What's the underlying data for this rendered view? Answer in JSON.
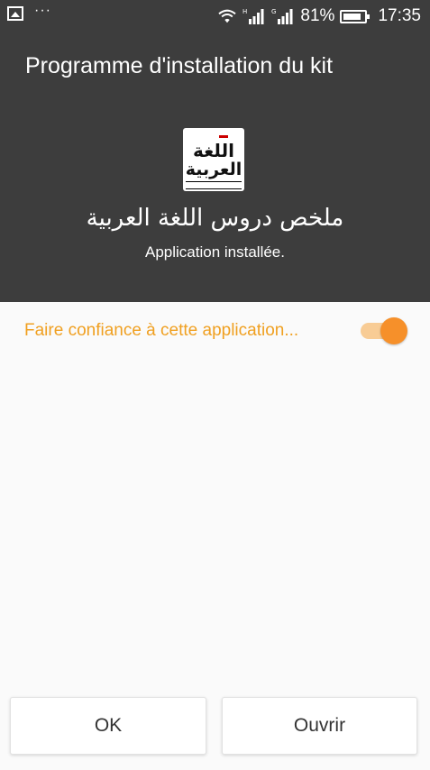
{
  "status_bar": {
    "battery": "81%",
    "time": "17:35",
    "dots": "···",
    "signal_labels": [
      "H",
      "G"
    ]
  },
  "header": {
    "title": "Programme d'installation du kit",
    "app_icon": {
      "line1": "اللغة",
      "line2": "العربية"
    },
    "app_name": "ملخص دروس اللغة العربية",
    "status_text": "Application installée."
  },
  "trust": {
    "label": "Faire confiance à cette application...",
    "enabled": true
  },
  "buttons": {
    "ok": "OK",
    "open": "Ouvrir"
  },
  "colors": {
    "header_bg": "#3d3d3d",
    "accent_orange": "#f6902a",
    "accent_text": "#f0a021",
    "body_bg": "#fafafa"
  }
}
